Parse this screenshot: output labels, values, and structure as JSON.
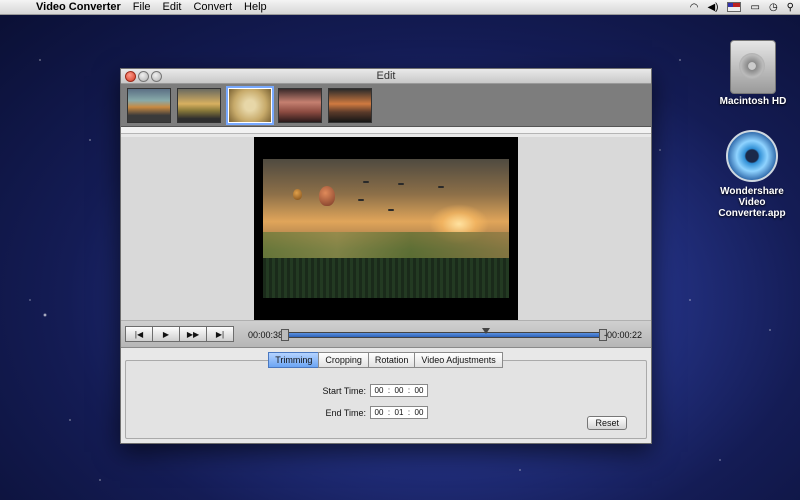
{
  "menubar": {
    "app_name": "Video Converter",
    "items": [
      "File",
      "Edit",
      "Convert",
      "Help"
    ]
  },
  "desktop": {
    "icons": [
      {
        "label": "Macintosh HD"
      },
      {
        "label": "Wondershare Video Converter.app"
      }
    ]
  },
  "window": {
    "title": "Edit"
  },
  "player": {
    "elapsed": "00:00:38",
    "remaining": "-00:00:22"
  },
  "tabs": [
    "Trimming",
    "Cropping",
    "Rotation",
    "Video Adjustments"
  ],
  "active_tab": "Trimming",
  "trimming": {
    "start_label": "Start Time:",
    "start": {
      "h": "00",
      "m": "00",
      "s": "00"
    },
    "end_label": "End  Time:",
    "end": {
      "h": "00",
      "m": "01",
      "s": "00"
    },
    "sep": ":",
    "reset_label": "Reset"
  },
  "colors": {
    "accent": "#6ca5f4",
    "track": "#2e62b8"
  }
}
